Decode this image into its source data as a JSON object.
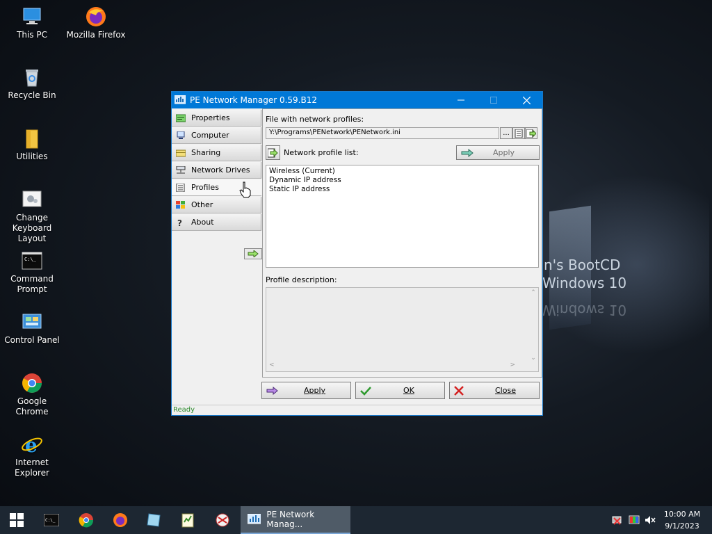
{
  "desktop": {
    "icons": [
      {
        "label": "This PC"
      },
      {
        "label": "Mozilla Firefox"
      },
      {
        "label": "Recycle Bin"
      },
      {
        "label": "Utilities"
      },
      {
        "label": "Change Keyboard Layout"
      },
      {
        "label": "Command Prompt"
      },
      {
        "label": "Control Panel"
      },
      {
        "label": "Google Chrome"
      },
      {
        "label": "Internet Explorer"
      }
    ],
    "wallpaper": {
      "line1": "n's BootCD",
      "line2": "Windows 10",
      "line3": "Windows 10"
    }
  },
  "window": {
    "title": "PE Network Manager 0.59.B12",
    "sidebar": {
      "items": [
        {
          "label": "Properties"
        },
        {
          "label": "Computer"
        },
        {
          "label": "Sharing"
        },
        {
          "label": "Network Drives"
        },
        {
          "label": "Profiles"
        },
        {
          "label": "Other"
        },
        {
          "label": "About"
        }
      ],
      "active": "Profiles"
    },
    "content": {
      "file_label": "File with network profiles:",
      "file_path": "Y:\\Programs\\PENetwork\\PENetwork.ini",
      "browse_label": "...",
      "list_label": "Network profile list:",
      "list_apply_label": "Apply",
      "profiles": [
        "Wireless (Current)",
        "Dynamic IP address",
        "Static IP address"
      ],
      "desc_label": "Profile description:"
    },
    "buttons": {
      "apply": "Apply",
      "ok": "OK",
      "close": "Close"
    },
    "status": "Ready"
  },
  "taskbar": {
    "task_label": "PE Network Manag...",
    "time": "10:00 AM",
    "date": "9/1/2023"
  },
  "colors": {
    "accent": "#0078d7",
    "status_green": "#2e8b2e",
    "taskbar": "#1d2732"
  }
}
